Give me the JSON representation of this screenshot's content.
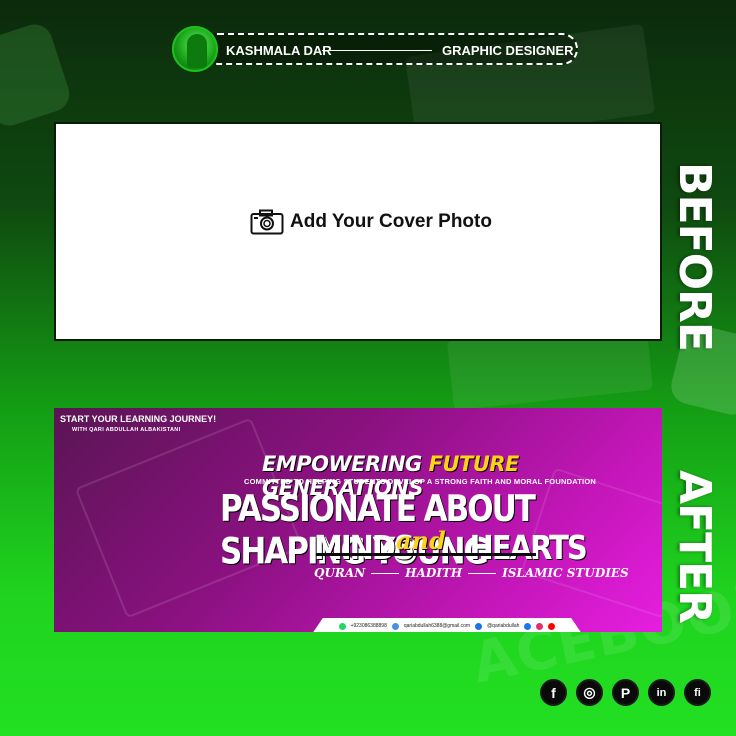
{
  "header": {
    "name": "KASHMALA DAR",
    "role": "GRAPHIC DESIGNER"
  },
  "before": {
    "placeholder_text": "Add Your Cover Photo",
    "label": "BEFORE"
  },
  "after": {
    "label": "AFTER",
    "top_left_line1": "START YOUR LEARNING JOURNEY!",
    "top_left_line2": "WITH QARI ABDULLAH ALBAKISTANI",
    "headline_part1": "EMPOWERING ",
    "headline_highlight": "FUTURE",
    "headline_part2": " GENERATIONS",
    "subheadline": "COMMITTED TO HELPING STUDENTS DEVELOP A STRONG FAITH AND MORAL FOUNDATION",
    "big_line1": "PASSIONATE ABOUT SHAPING YOUNG",
    "big_line2": "MINDS       HEARTS",
    "script_word": "and",
    "topics": [
      "QURAN",
      "HADITH",
      "ISLAMIC STUDIES"
    ],
    "contact": {
      "phone": "+923086388898",
      "email": "qariabdullah6388@gmail.com",
      "handle": "@qariabdullah"
    }
  },
  "socials": [
    {
      "icon": "facebook-icon",
      "glyph": "f"
    },
    {
      "icon": "instagram-icon",
      "glyph": "◎"
    },
    {
      "icon": "pinterest-icon",
      "glyph": "P"
    },
    {
      "icon": "linkedin-icon",
      "glyph": "in"
    },
    {
      "icon": "fiverr-icon",
      "glyph": "fi"
    }
  ],
  "colors": {
    "accent_green": "#1fd21f",
    "banner_magenta": "#c316b8",
    "headline_yellow": "#ffd21a"
  }
}
